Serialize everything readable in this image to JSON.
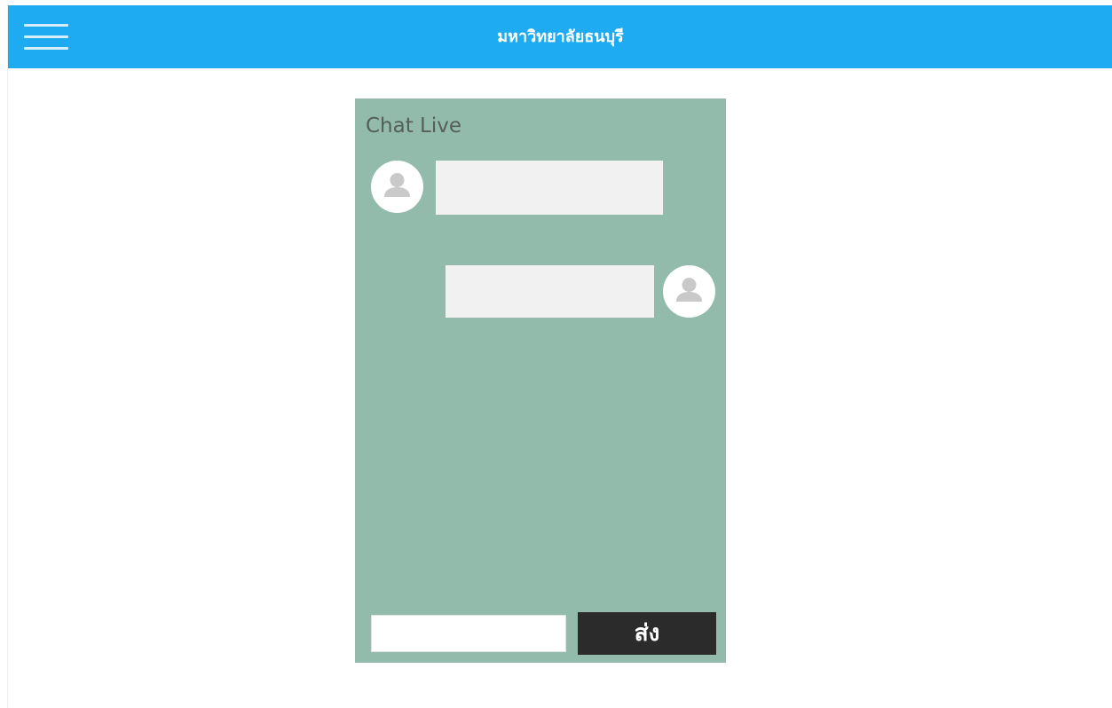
{
  "header": {
    "title": "มหาวิทยาลัยธนบุรี",
    "menu_icon": "hamburger-menu-icon",
    "background_color": "#1eabf2"
  },
  "chat": {
    "title": "Chat Live",
    "panel_color": "#92bbab",
    "messages": [
      {
        "side": "left",
        "text": "",
        "avatar_icon": "user-avatar-icon"
      },
      {
        "side": "right",
        "text": "",
        "avatar_icon": "user-avatar-icon"
      }
    ],
    "input": {
      "value": "",
      "placeholder": ""
    },
    "send_label": "ส่ง"
  }
}
